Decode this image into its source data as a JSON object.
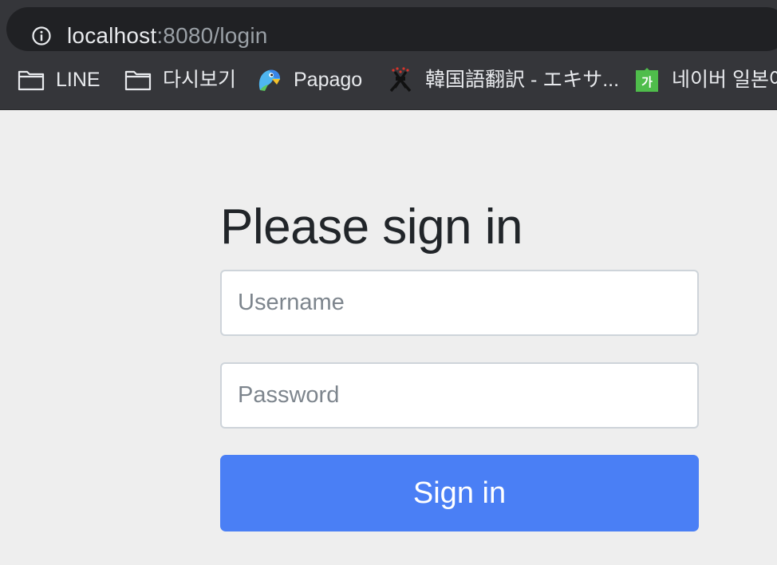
{
  "browser": {
    "url_host": "localhost",
    "url_rest": ":8080/login",
    "bookmarks": [
      {
        "label": "LINE",
        "icon": "folder-icon"
      },
      {
        "label": "다시보기",
        "icon": "folder-icon"
      },
      {
        "label": "Papago",
        "icon": "papago-parrot-icon"
      },
      {
        "label": "韓国語翻訳 - エキサ...",
        "icon": "excite-icon"
      },
      {
        "label": "네이버 일본어",
        "icon": "naver-dictionary-ga-icon"
      }
    ],
    "naver_icon_text": "가"
  },
  "login": {
    "heading": "Please sign in",
    "username_placeholder": "Username",
    "password_placeholder": "Password",
    "submit_label": "Sign in"
  },
  "colors": {
    "page_background": "#eeeeee",
    "primary_button": "#4a7ff5",
    "browser_chrome": "#35363a"
  }
}
